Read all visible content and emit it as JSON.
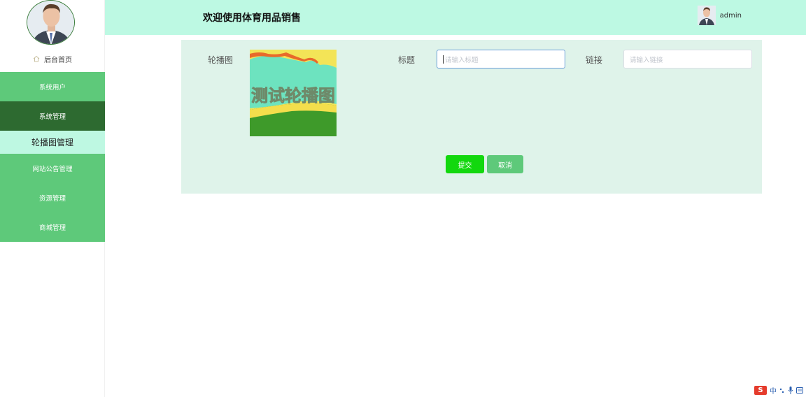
{
  "header": {
    "title": "欢迎使用体育用品销售",
    "username": "admin"
  },
  "sidebar": {
    "home_label": "后台首页",
    "items": [
      {
        "label": "系统用户"
      },
      {
        "label": "系统管理"
      },
      {
        "label": "轮播图管理"
      },
      {
        "label": "网站公告管理"
      },
      {
        "label": "资源管理"
      },
      {
        "label": "商城管理"
      }
    ]
  },
  "form": {
    "image_label": "轮播图",
    "image_text": "测试轮播图",
    "title_label": "标题",
    "title_placeholder": "请输入标题",
    "link_label": "链接",
    "link_placeholder": "请输入链接",
    "submit_label": "提交",
    "cancel_label": "取消"
  },
  "ime": {
    "mode": "中",
    "logo": "S"
  },
  "colors": {
    "sidebar_green": "#5ec97a",
    "active_dark": "#2d6a30",
    "header_bg": "#bdf9e3",
    "submit_green": "#12d80e"
  }
}
